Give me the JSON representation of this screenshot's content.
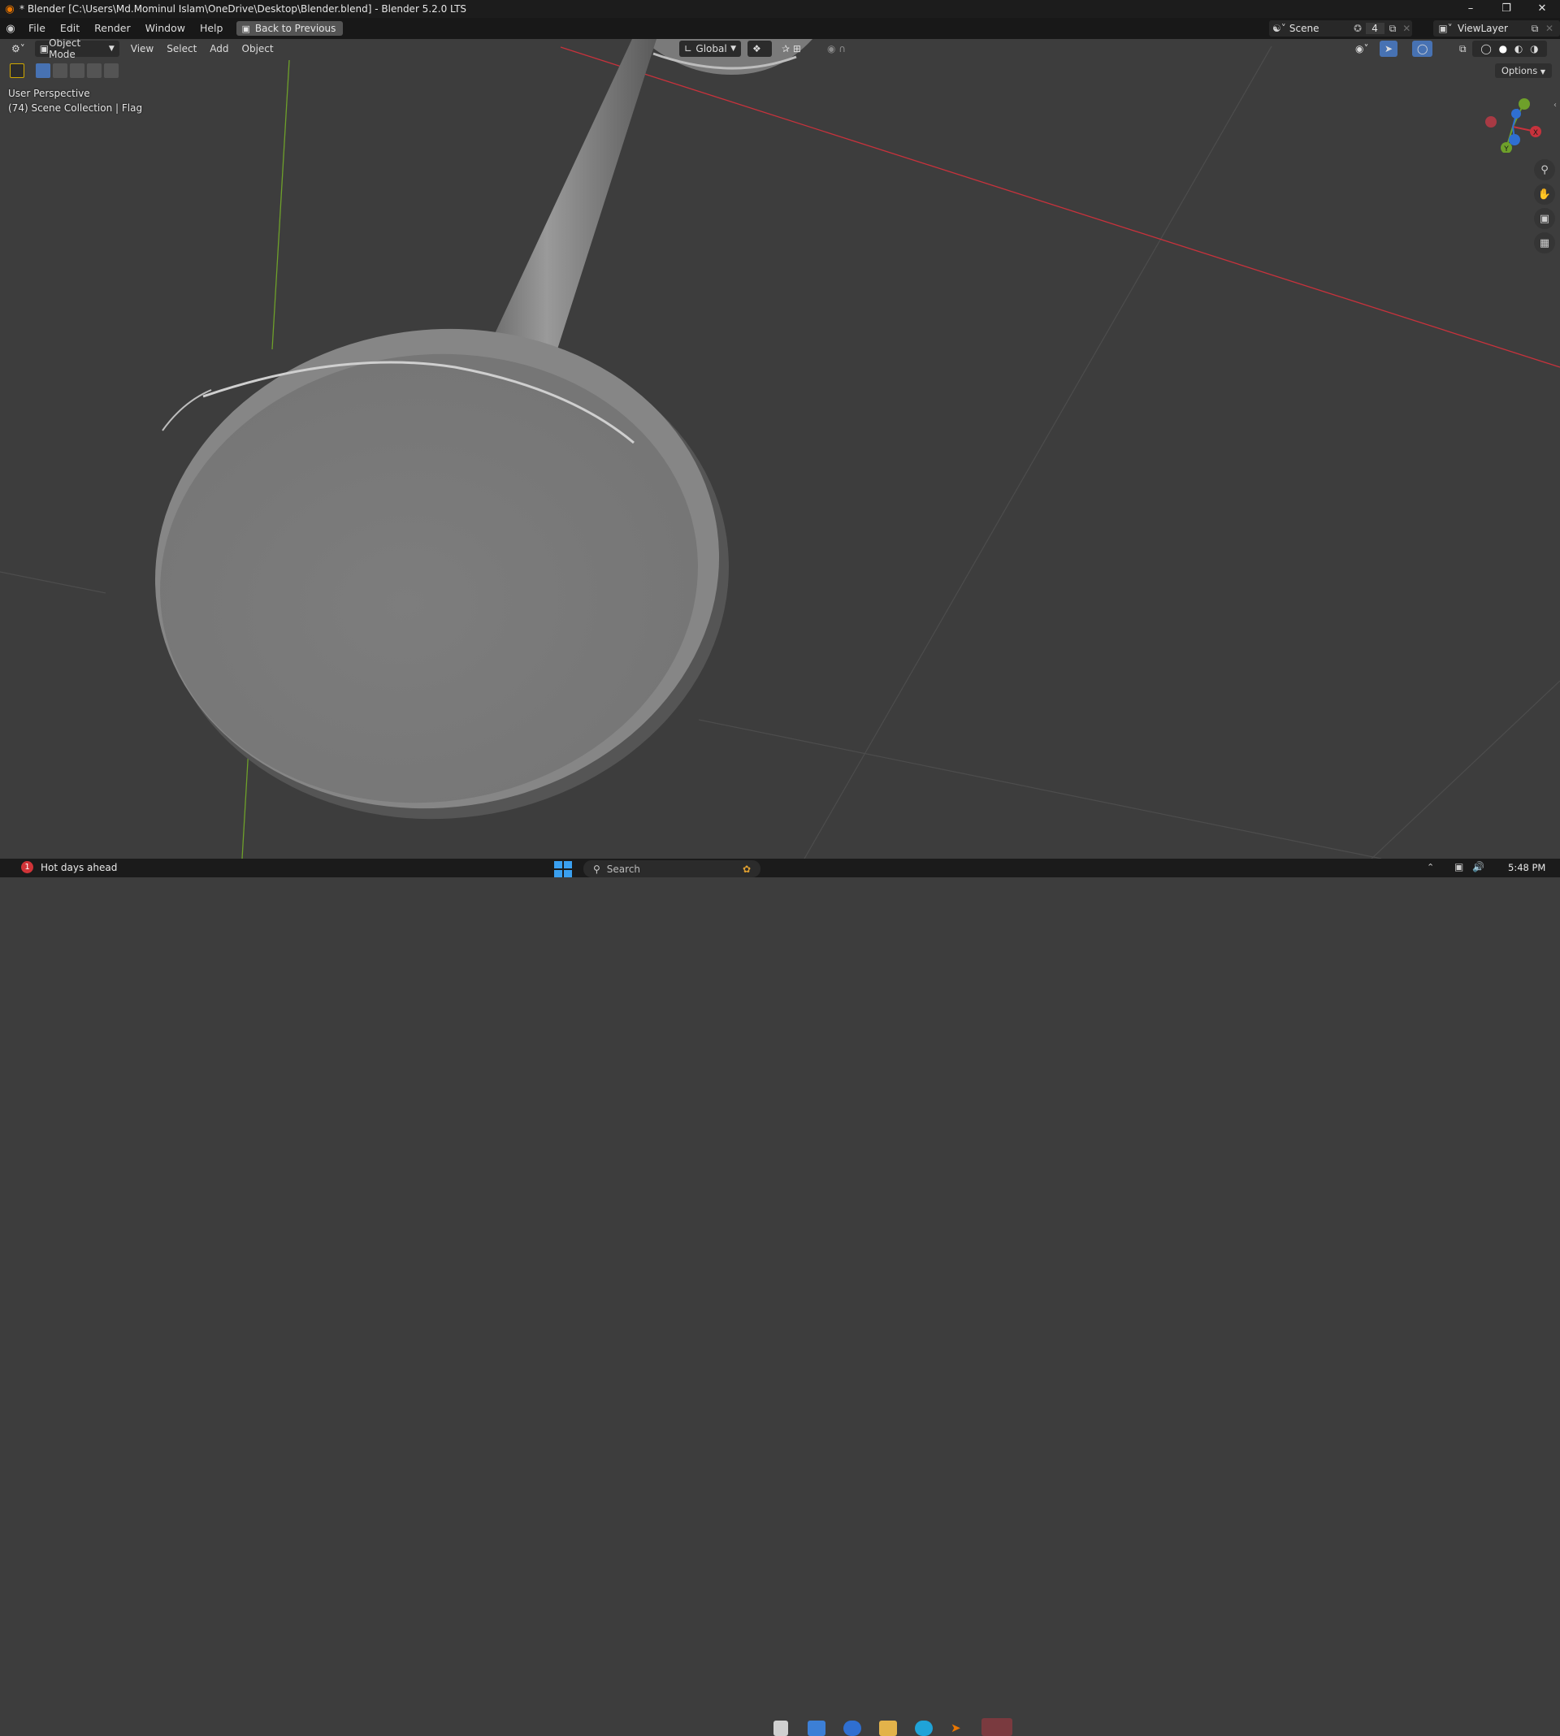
{
  "window": {
    "title": "* Blender [C:\\Users\\Md.Mominul Islam\\OneDrive\\Desktop\\Blender.blend] - Blender 5.2.0 LTS",
    "minimize": "–",
    "maximize": "❐",
    "close": "✕"
  },
  "menubar": {
    "items": [
      "File",
      "Edit",
      "Render",
      "Window",
      "Help"
    ],
    "back_button": "Back to Previous",
    "scene_label": "Scene",
    "scene_users": "4",
    "viewlayer_label": "ViewLayer"
  },
  "header": {
    "mode": "Object Mode",
    "menus": [
      "View",
      "Select",
      "Add",
      "Object"
    ],
    "transform_orientation": "Global",
    "options_label": "Options"
  },
  "viewport": {
    "perspective": "User Perspective",
    "collection": "(74) Scene Collection | Flag",
    "gizmo_axes": [
      "X",
      "Y",
      "Z"
    ]
  },
  "statusbar": {
    "notification_count": "1",
    "weather": "Hot days ahead",
    "search_placeholder": "Search",
    "time": "5:48 PM"
  },
  "colors": {
    "x_axis": "#c8323c",
    "y_axis": "#6ea02a",
    "z_axis": "#2f6fd1",
    "active_tool": "#4772b3",
    "blender_orange": "#ea7600"
  }
}
